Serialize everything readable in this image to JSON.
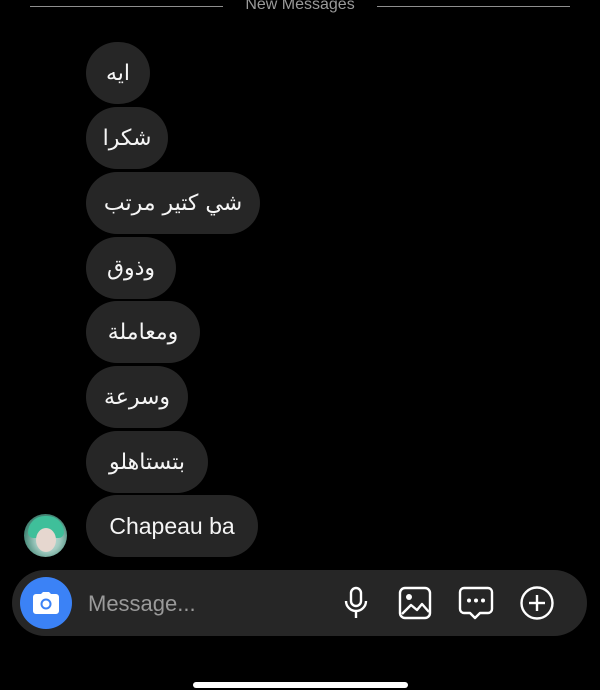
{
  "divider": {
    "label": "New Messages"
  },
  "messages": [
    {
      "text": "ايه"
    },
    {
      "text": "شكرا"
    },
    {
      "text": "شي كتير مرتب"
    },
    {
      "text": "وذوق"
    },
    {
      "text": "ومعاملة"
    },
    {
      "text": "وسرعة"
    },
    {
      "text": "بتستاهلو"
    },
    {
      "text": "Chapeau ba"
    }
  ],
  "composer": {
    "placeholder": "Message...",
    "icons": [
      "camera-icon",
      "microphone-icon",
      "gallery-icon",
      "sticker-icon",
      "plus-icon"
    ],
    "camera_color": "#3b82f6"
  },
  "colors": {
    "background": "#000000",
    "bubble": "#262626",
    "muted_text": "#9a9a9a"
  }
}
